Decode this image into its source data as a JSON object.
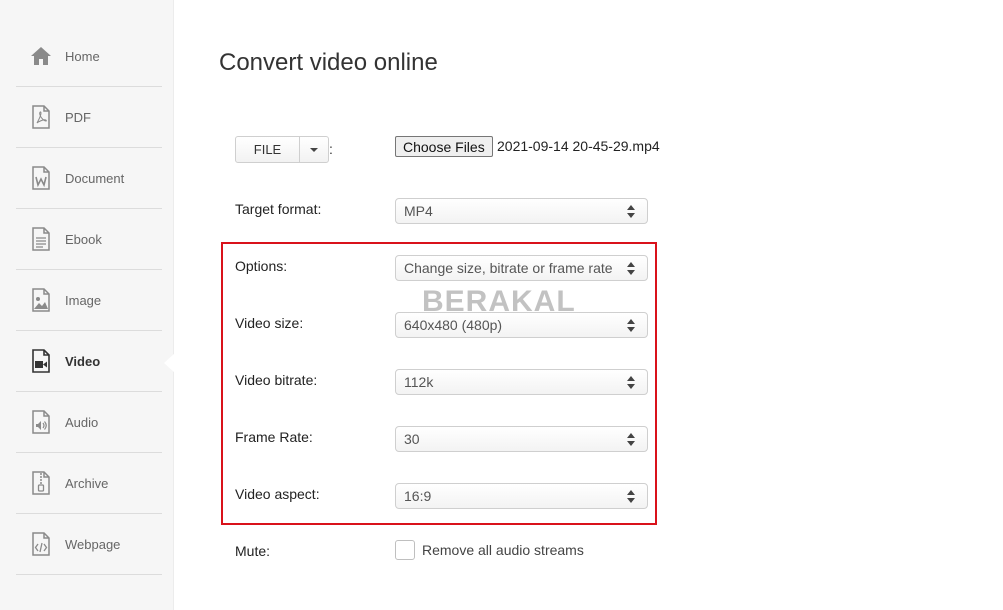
{
  "sidebar": {
    "items": [
      {
        "label": "Home",
        "icon": "home-icon"
      },
      {
        "label": "PDF",
        "icon": "pdf-icon"
      },
      {
        "label": "Document",
        "icon": "document-icon"
      },
      {
        "label": "Ebook",
        "icon": "ebook-icon"
      },
      {
        "label": "Image",
        "icon": "image-icon"
      },
      {
        "label": "Video",
        "icon": "video-icon",
        "active": true
      },
      {
        "label": "Audio",
        "icon": "audio-icon"
      },
      {
        "label": "Archive",
        "icon": "archive-icon"
      },
      {
        "label": "Webpage",
        "icon": "webpage-icon"
      }
    ]
  },
  "main": {
    "title": "Convert video online",
    "file": {
      "source_label": "FILE",
      "colon": ":",
      "choose_label": "Choose Files",
      "file_name": "2021-09-14 20-45-29.mp4"
    },
    "target_format": {
      "label": "Target format:",
      "value": "MP4"
    },
    "options": {
      "label": "Options:",
      "value": "Change size, bitrate or frame rate"
    },
    "video_size": {
      "label": "Video size:",
      "value": "640x480 (480p)"
    },
    "video_bitrate": {
      "label": "Video bitrate:",
      "value": "112k"
    },
    "frame_rate": {
      "label": "Frame Rate:",
      "value": "30"
    },
    "video_aspect": {
      "label": "Video aspect:",
      "value": "16:9"
    },
    "mute": {
      "label": "Mute:",
      "checkbox_label": "Remove all audio streams",
      "checked": false
    }
  },
  "watermark": "BERAKAL",
  "colors": {
    "highlight": "#d9121b",
    "sidebar_bg": "#f6f6f6",
    "icon": "#8a8a8a"
  }
}
